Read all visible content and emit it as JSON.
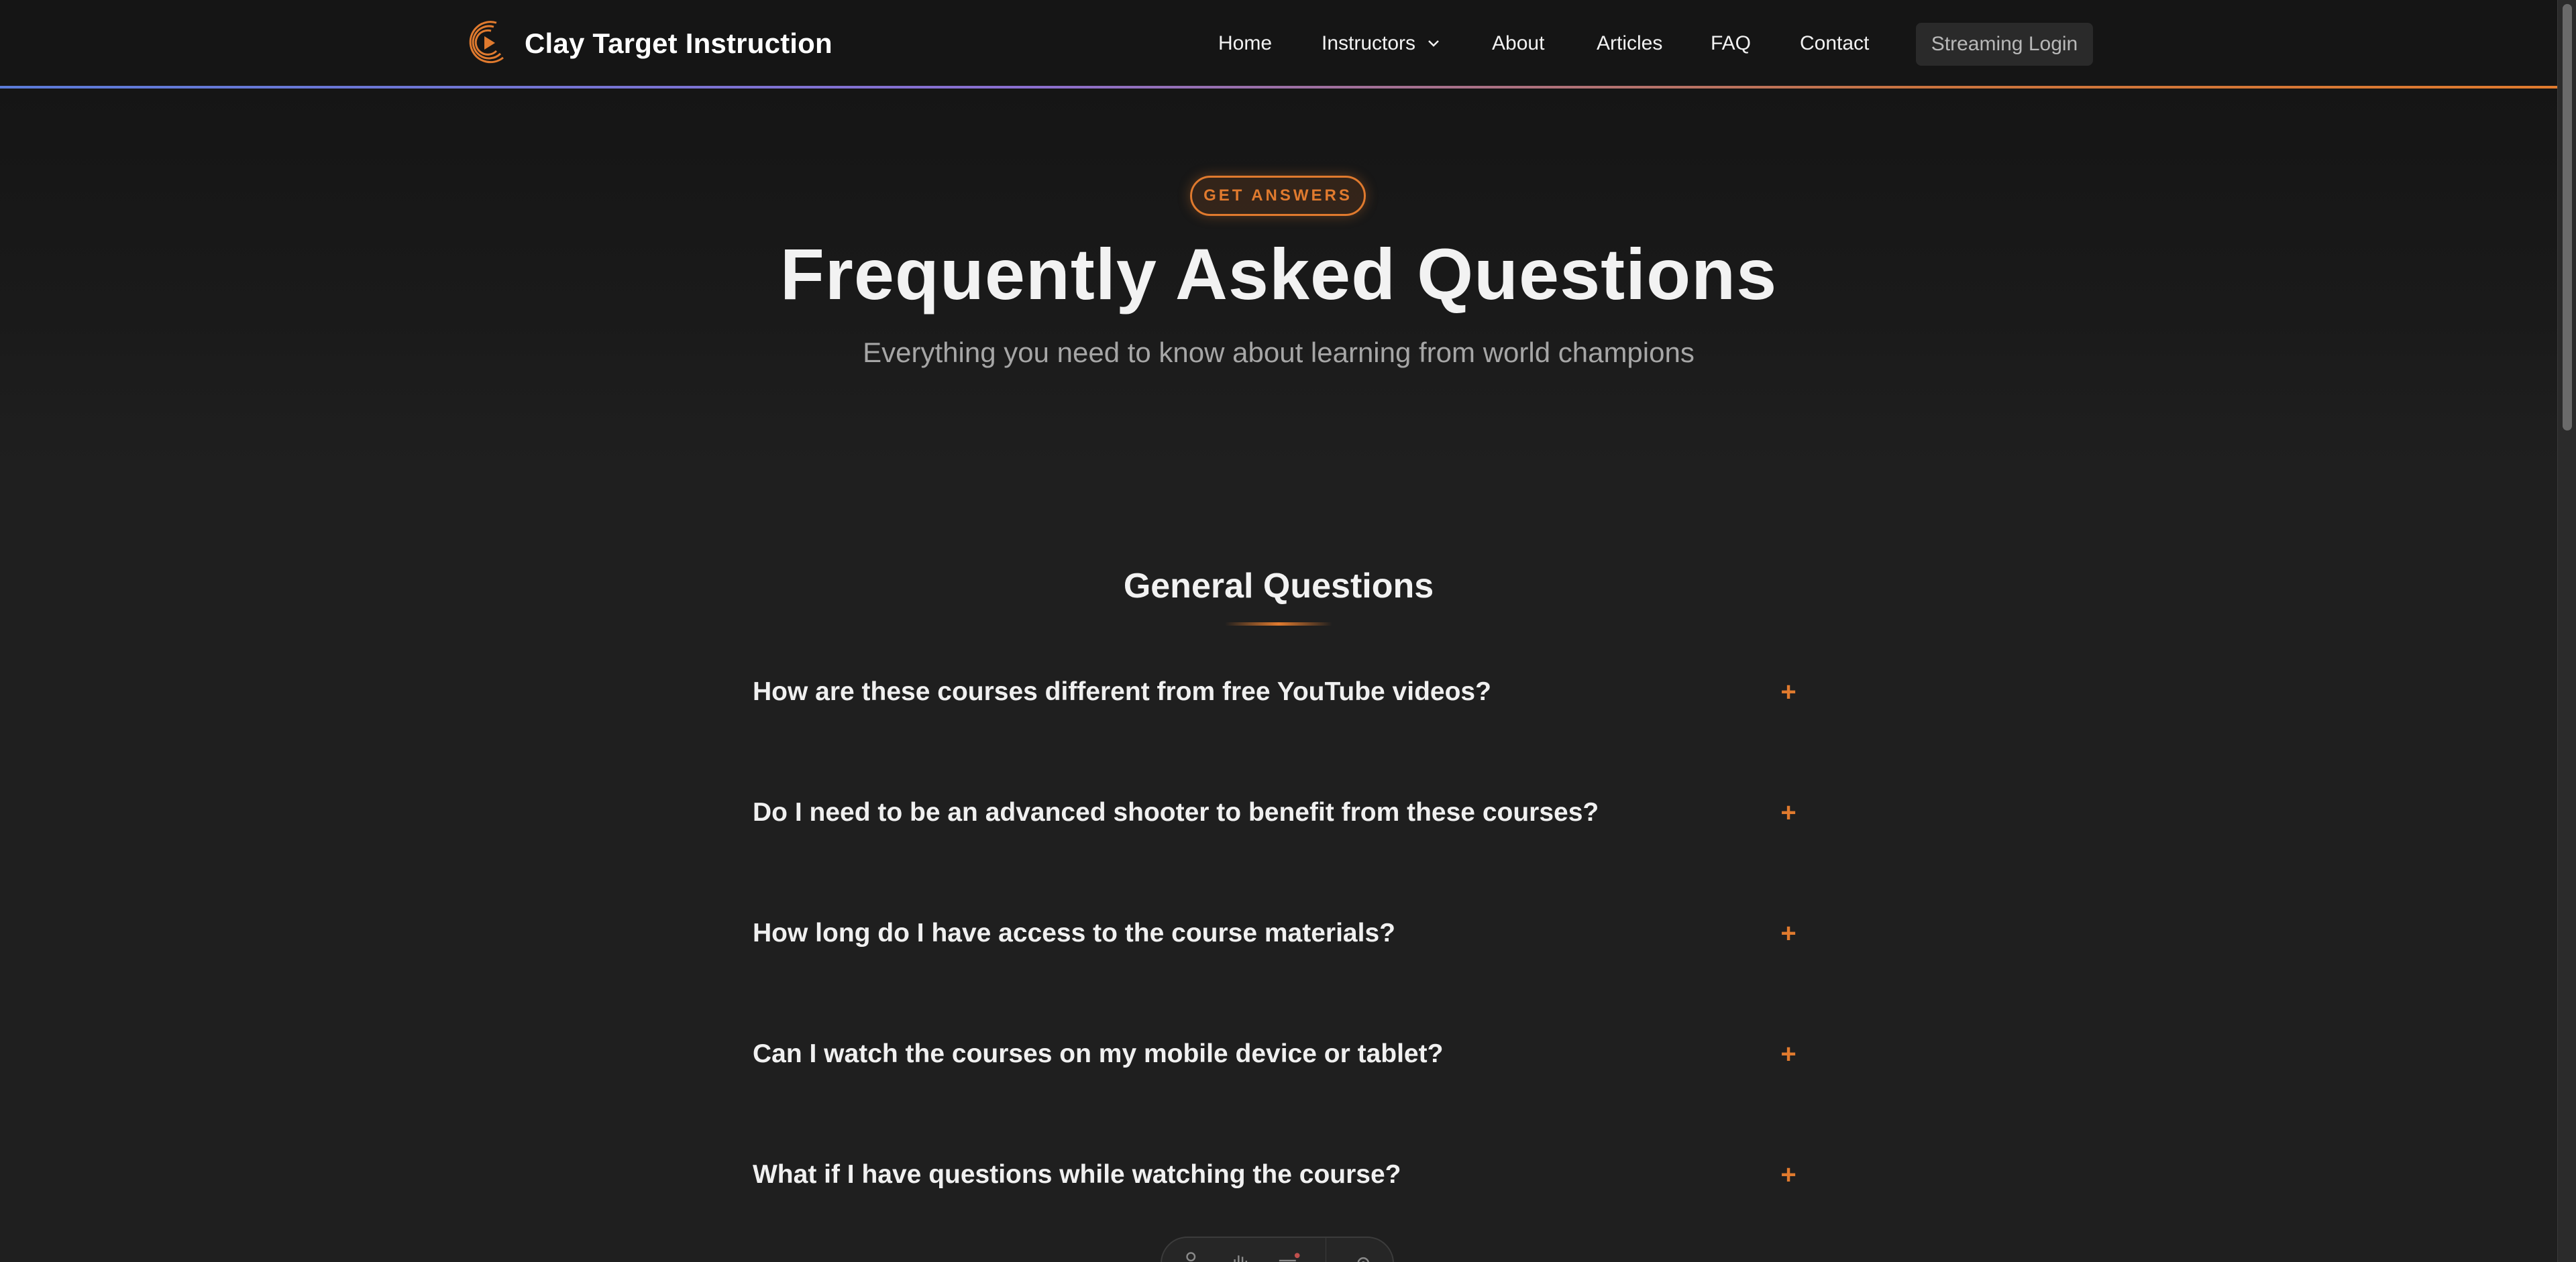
{
  "nav": {
    "brand_name": "Clay Target Instruction",
    "links": {
      "home": "Home",
      "instructors": "Instructors",
      "about": "About",
      "articles": "Articles",
      "faq": "FAQ",
      "contact": "Contact"
    },
    "login_label": "Streaming Login"
  },
  "hero": {
    "badge": "GET ANSWERS",
    "title": "Frequently Asked Questions",
    "subtitle": "Everything you need to know about learning from world champions"
  },
  "section": {
    "title": "General Questions",
    "questions": [
      "How are these courses different from free YouTube videos?",
      "Do I need to be an advanced shooter to benefit from these courses?",
      "How long do I have access to the course materials?",
      "Can I watch the courses on my mobile device or tablet?",
      "What if I have questions while watching the course?"
    ],
    "expand_symbol": "+"
  },
  "icons": {
    "brand": "play-logo-icon",
    "dropdown": "chevron-down-icon",
    "expand": "plus-icon",
    "toolbar": [
      "user-icon",
      "hand-icon",
      "list-icon",
      "gear-icon"
    ]
  },
  "colors": {
    "accent": "#e07a2e",
    "background": "#1f1f1f",
    "navbar": "#151515",
    "gradient_start": "#5b7bd8"
  }
}
